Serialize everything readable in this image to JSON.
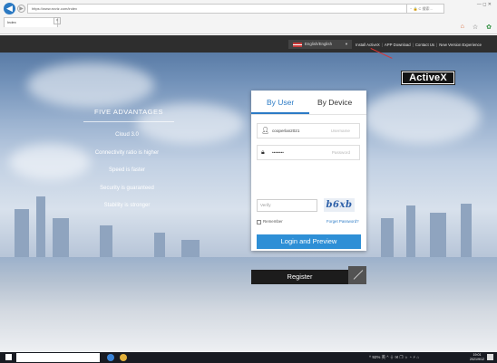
{
  "browser": {
    "url": "https://www.ezviz.com/index",
    "search_text": "~ 🔒 C 搜索...",
    "tab_title": "Index",
    "right_mini": "ρ·  ☆ ✰ ☺",
    "window_controls": "—  ◻  ✕"
  },
  "site": {
    "topbar": {
      "language": "English/English",
      "links": [
        "Install ActiveX",
        "APP Download",
        "Contact Us",
        "New Version Experience"
      ]
    },
    "activex_badge": "ActiveX",
    "advantages": {
      "title": "FIVE ADVANTAGES",
      "items": [
        "Cloud 3.0",
        "Connectivity ratio is higher",
        "Speed is faster",
        "Security is guaranteed",
        "Stability is stronger"
      ]
    },
    "login": {
      "tab_user": "By User",
      "tab_device": "By Device",
      "username_value": "cooperlan2021",
      "username_placeholder": "Username",
      "password_value": "••••••••",
      "password_placeholder": "Password",
      "verify_placeholder": "Verify",
      "captcha_text": "b6xb",
      "remember_label": "Remember",
      "forgot_label": "Forget Password?",
      "login_button": "Login and Preview",
      "register_button": "Register"
    }
  },
  "taskbar": {
    "tray_text": "^ 92% 英 ^  ⏚ ✉ ❐ ☼ ◔ ⚡ ⌂",
    "time": "19:01",
    "date": "2021/9/12"
  },
  "colors": {
    "accent": "#2c7bc6",
    "login_button": "#2e8fd6",
    "topbar": "#2e2e2e",
    "register": "#1c1c1c"
  }
}
